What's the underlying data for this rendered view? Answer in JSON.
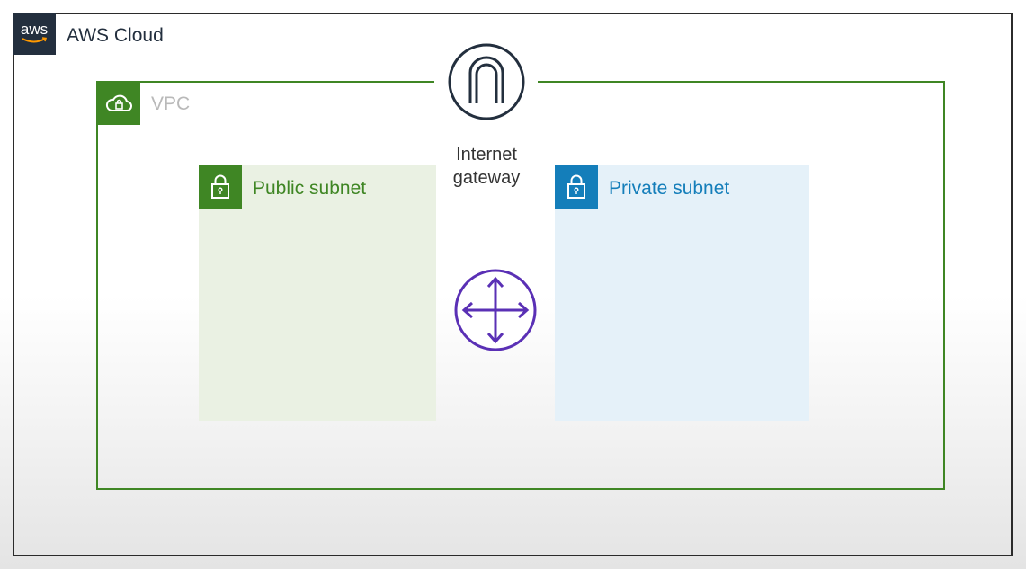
{
  "aws_cloud": {
    "logo_text": "aws",
    "label": "AWS Cloud"
  },
  "vpc": {
    "label": "VPC",
    "icon": "vpc-cloud-lock-icon"
  },
  "internet_gateway": {
    "label_line1": "Internet",
    "label_line2": "gateway",
    "icon": "internet-gateway-icon"
  },
  "public_subnet": {
    "label": "Public subnet",
    "icon": "lock-icon"
  },
  "private_subnet": {
    "label": "Private subnet",
    "icon": "lock-icon"
  },
  "router": {
    "icon": "router-icon"
  },
  "colors": {
    "aws_dark": "#232f3e",
    "vpc_green": "#3f8624",
    "private_blue": "#147eba",
    "router_purple": "#5a30b5"
  }
}
